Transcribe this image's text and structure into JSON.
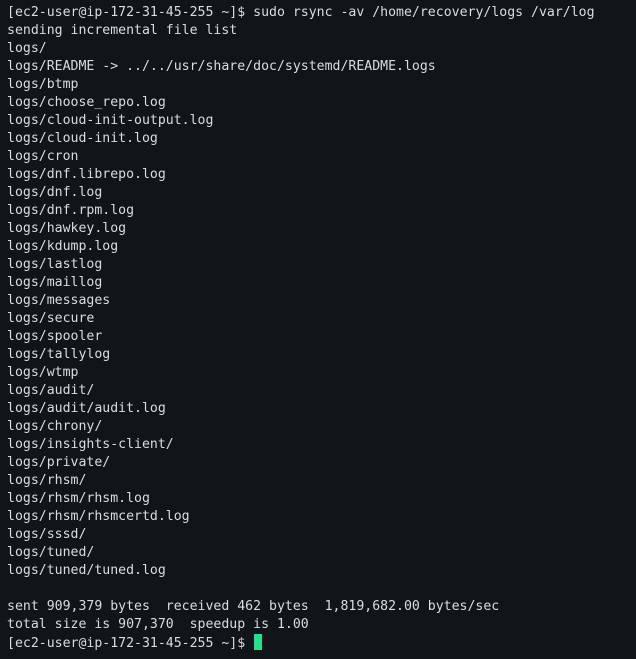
{
  "terminal": {
    "prompt": "[ec2-user@ip-172-31-45-255 ~]$ ",
    "command": "sudo rsync -av /home/recovery/logs /var/log",
    "lines": [
      "sending incremental file list",
      "logs/",
      "logs/README -> ../../usr/share/doc/systemd/README.logs",
      "logs/btmp",
      "logs/choose_repo.log",
      "logs/cloud-init-output.log",
      "logs/cloud-init.log",
      "logs/cron",
      "logs/dnf.librepo.log",
      "logs/dnf.log",
      "logs/dnf.rpm.log",
      "logs/hawkey.log",
      "logs/kdump.log",
      "logs/lastlog",
      "logs/maillog",
      "logs/messages",
      "logs/secure",
      "logs/spooler",
      "logs/tallylog",
      "logs/wtmp",
      "logs/audit/",
      "logs/audit/audit.log",
      "logs/chrony/",
      "logs/insights-client/",
      "logs/private/",
      "logs/rhsm/",
      "logs/rhsm/rhsm.log",
      "logs/rhsm/rhsmcertd.log",
      "logs/sssd/",
      "logs/tuned/",
      "logs/tuned/tuned.log",
      "",
      "sent 909,379 bytes  received 462 bytes  1,819,682.00 bytes/sec",
      "total size is 907,370  speedup is 1.00"
    ],
    "final_prompt": "[ec2-user@ip-172-31-45-255 ~]$ ",
    "colors": {
      "background": "#111418",
      "foreground": "#d8dde2",
      "cursor": "#25e08a"
    }
  }
}
